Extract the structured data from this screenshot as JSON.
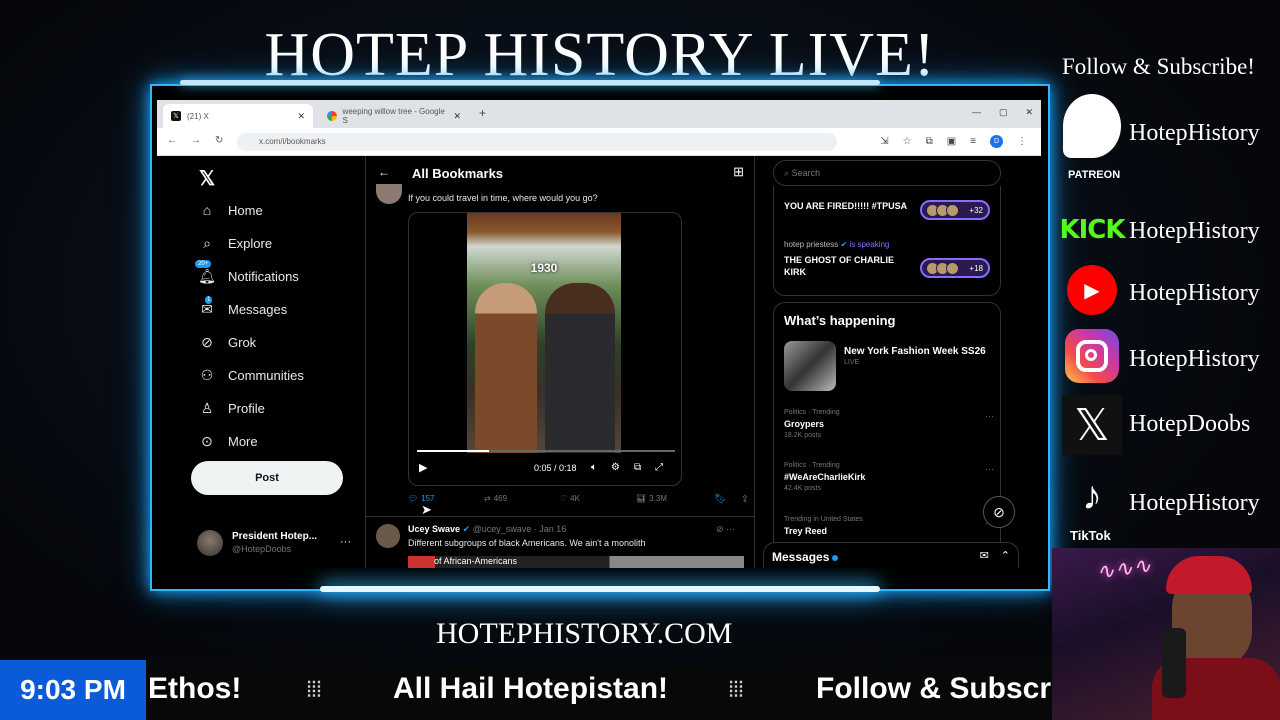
{
  "overlay": {
    "title": "HOTEP HISTORY LIVE!",
    "website": "HOTEPHISTORY.COM",
    "follow_heading": "Follow & Subscribe!",
    "socials": [
      {
        "platform": "patreon",
        "icon": "patreon-icon",
        "label": "PATREON",
        "handle": "HotepHistory"
      },
      {
        "platform": "kick",
        "icon": "kick-icon",
        "logo_text": "KICK",
        "handle": "HotepHistory"
      },
      {
        "platform": "youtube",
        "icon": "youtube-icon",
        "handle": "HotepHistory"
      },
      {
        "platform": "instagram",
        "icon": "instagram-icon",
        "handle": "HotepHistory"
      },
      {
        "platform": "x",
        "icon": "x-icon",
        "handle": "HotepDoobs"
      },
      {
        "platform": "tiktok",
        "icon": "tiktok-icon",
        "label": "TikTok",
        "handle": "HotepHistory"
      }
    ],
    "ticker": {
      "clock": "9:03 PM",
      "items": [
        "Ethos!",
        "All Hail Hotepistan!",
        "Follow & Subscrib"
      ]
    },
    "accent_color": "#2fb6ff",
    "ticker_clock_color": "#0b5bd8"
  },
  "browser": {
    "tabs": [
      {
        "title": "(21) X",
        "icon": "x-favicon",
        "active": true
      },
      {
        "title": "weeping willow tree - Google S",
        "icon": "google-favicon",
        "active": false
      }
    ],
    "url": "x.com/i/bookmarks"
  },
  "x_app": {
    "nav": [
      {
        "label": "Home",
        "icon": "home-icon"
      },
      {
        "label": "Explore",
        "icon": "search-icon"
      },
      {
        "label": "Notifications",
        "icon": "bell-icon",
        "badge": "20+"
      },
      {
        "label": "Messages",
        "icon": "mail-icon",
        "badge": "1"
      },
      {
        "label": "Grok",
        "icon": "grok-icon"
      },
      {
        "label": "Communities",
        "icon": "communities-icon"
      },
      {
        "label": "Profile",
        "icon": "profile-icon"
      },
      {
        "label": "More",
        "icon": "more-icon"
      }
    ],
    "post_button": "Post",
    "account": {
      "name": "President Hotep...",
      "handle": "@HotepDoobs"
    },
    "bookmarks_title": "All Bookmarks",
    "tweet1": {
      "text": "If you could travel in time, where would you go?",
      "video_caption": "1930",
      "video_time": "0:05 / 0:18",
      "video_progress": 0.28,
      "replies": "157",
      "reposts": "469",
      "likes": "4K",
      "views": "3.3M"
    },
    "tweet2": {
      "name": "Ucey Swave",
      "handle": "@ucey_swave",
      "date": "Jan 16",
      "text": "Different subgroups of black Americans. We ain't a monolith",
      "image_text": "of African-Americans"
    },
    "search_placeholder": "Search",
    "spaces": [
      {
        "host": "",
        "title": "YOU ARE FIRED!!!!! #TPUSA",
        "count": "+32"
      },
      {
        "host": "hotep priestess",
        "status": "is speaking",
        "title": "THE GHOST OF CHARLIE KIRK",
        "count": "+18"
      }
    ],
    "whats_happening": {
      "title": "What’s happening",
      "event": {
        "name": "New York Fashion Week SS26",
        "status": "LIVE"
      },
      "trends": [
        {
          "category": "Politics · Trending",
          "name": "Groypers",
          "posts": "18.2K posts"
        },
        {
          "category": "Politics · Trending",
          "name": "#WeAreCharlieKirk",
          "posts": "42.4K posts"
        },
        {
          "category": "Trending in United States",
          "name": "Trey Reed",
          "posts": ""
        }
      ]
    },
    "messages_label": "Messages"
  }
}
